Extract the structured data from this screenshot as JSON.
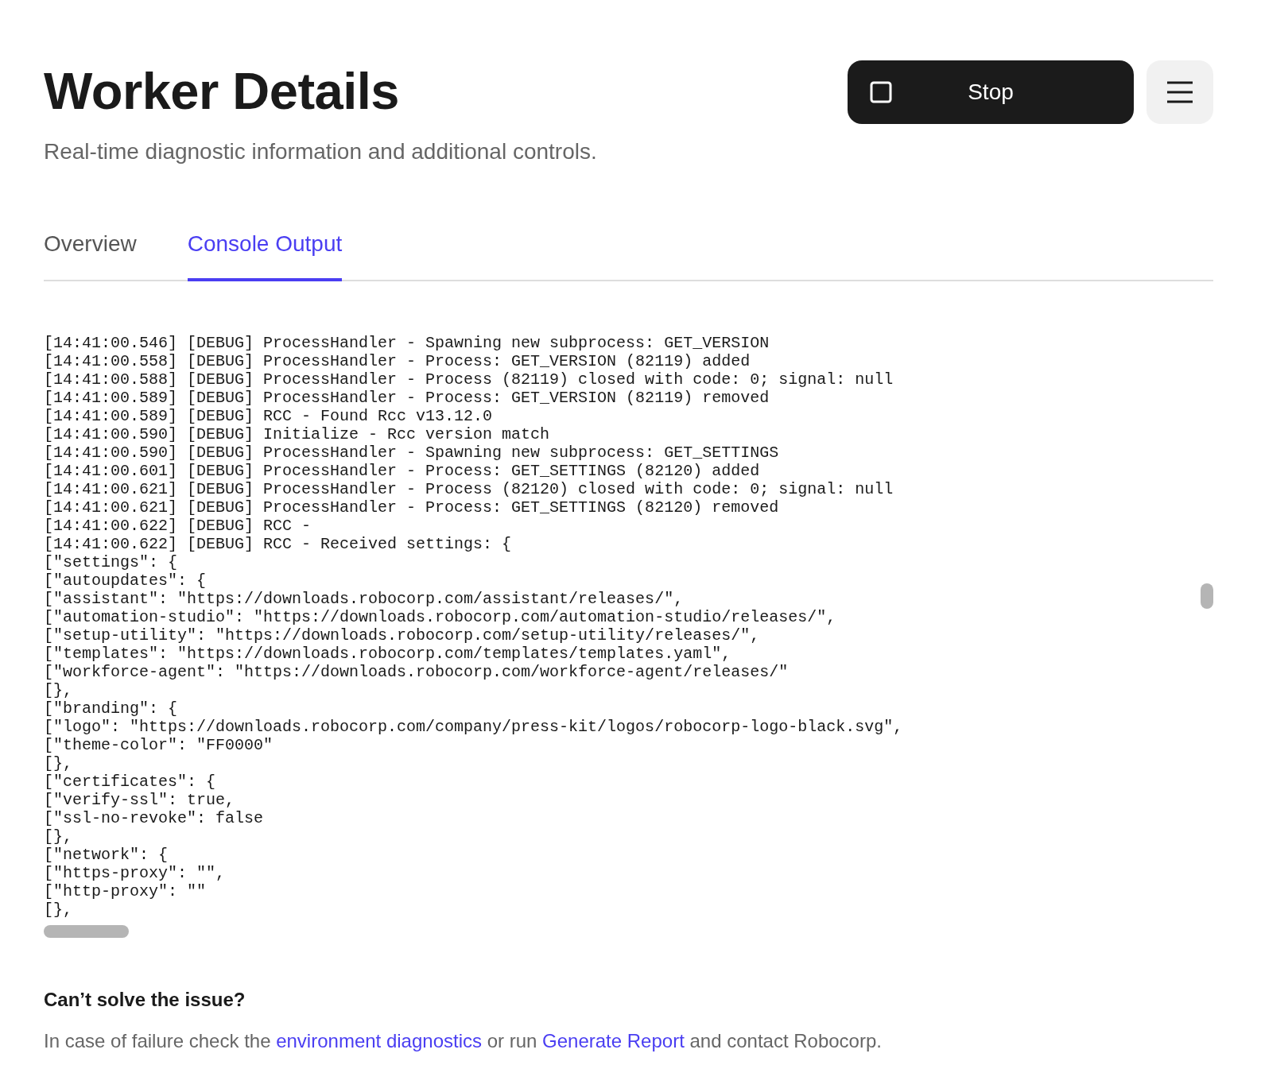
{
  "header": {
    "title": "Worker Details",
    "subtitle": "Real-time diagnostic information and additional controls.",
    "stop_button": {
      "label": "Stop"
    }
  },
  "tabs": [
    {
      "label": "Overview",
      "selected": false
    },
    {
      "label": "Console Output",
      "selected": true
    }
  ],
  "console": {
    "lines": [
      "[14:41:00.546] [DEBUG] ProcessHandler - Spawning new subprocess: GET_VERSION",
      "[14:41:00.558] [DEBUG] ProcessHandler - Process: GET_VERSION (82119) added",
      "[14:41:00.588] [DEBUG] ProcessHandler - Process (82119) closed with code: 0; signal: null",
      "[14:41:00.589] [DEBUG] ProcessHandler - Process: GET_VERSION (82119) removed",
      "[14:41:00.589] [DEBUG] RCC - Found Rcc v13.12.0",
      "[14:41:00.590] [DEBUG] Initialize - Rcc version match",
      "[14:41:00.590] [DEBUG] ProcessHandler - Spawning new subprocess: GET_SETTINGS",
      "[14:41:00.601] [DEBUG] ProcessHandler - Process: GET_SETTINGS (82120) added",
      "[14:41:00.621] [DEBUG] ProcessHandler - Process (82120) closed with code: 0; signal: null",
      "[14:41:00.621] [DEBUG] ProcessHandler - Process: GET_SETTINGS (82120) removed",
      "[14:41:00.622] [DEBUG] RCC -",
      "[14:41:00.622] [DEBUG] RCC - Received settings: {",
      "[\"settings\": {",
      "[\"autoupdates\": {",
      "[\"assistant\": \"https://downloads.robocorp.com/assistant/releases/\",",
      "[\"automation-studio\": \"https://downloads.robocorp.com/automation-studio/releases/\",",
      "[\"setup-utility\": \"https://downloads.robocorp.com/setup-utility/releases/\",",
      "[\"templates\": \"https://downloads.robocorp.com/templates/templates.yaml\",",
      "[\"workforce-agent\": \"https://downloads.robocorp.com/workforce-agent/releases/\"",
      "[},",
      "[\"branding\": {",
      "[\"logo\": \"https://downloads.robocorp.com/company/press-kit/logos/robocorp-logo-black.svg\",",
      "[\"theme-color\": \"FF0000\"",
      "[},",
      "[\"certificates\": {",
      "[\"verify-ssl\": true,",
      "[\"ssl-no-revoke\": false",
      "[},",
      "[\"network\": {",
      "[\"https-proxy\": \"\",",
      "[\"http-proxy\": \"\"",
      "[},"
    ]
  },
  "help": {
    "heading": "Can’t solve the issue?",
    "parts": [
      {
        "kind": "text",
        "text": "In case of failure check the"
      },
      {
        "kind": "link",
        "text": "environment diagnostics"
      },
      {
        "kind": "text",
        "text": "or run"
      },
      {
        "kind": "link",
        "text": "Generate Report"
      },
      {
        "kind": "text",
        "text": "and contact Robocorp."
      }
    ]
  }
}
